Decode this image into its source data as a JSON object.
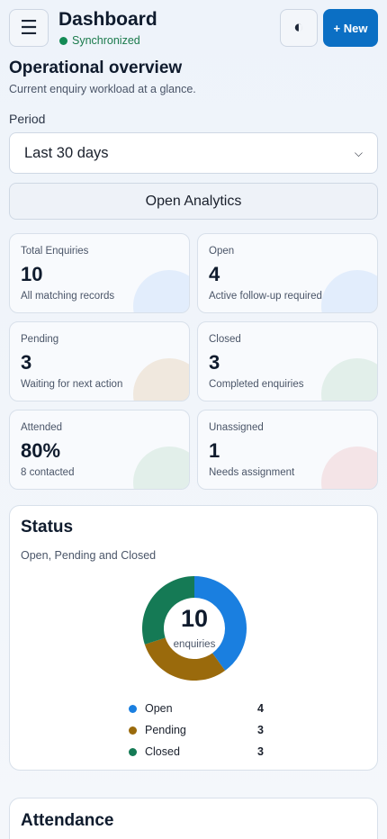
{
  "header": {
    "menu_icon": "☰",
    "title": "Dashboard",
    "sync_status": "Synchronized",
    "theme_icon": "◐",
    "new_label": "+ New"
  },
  "overview": {
    "title": "Operational overview",
    "subtitle": "Current enquiry workload at a glance.",
    "period_label": "Period",
    "period_value": "Last 30 days",
    "analytics_label": "Open Analytics"
  },
  "cards": [
    {
      "label": "Total Enquiries",
      "value": "10",
      "note": "All matching records",
      "accent": "#cfe2fb"
    },
    {
      "label": "Open",
      "value": "4",
      "note": "Active follow-up required",
      "accent": "#cfe2fb"
    },
    {
      "label": "Pending",
      "value": "3",
      "note": "Waiting for next action",
      "accent": "#ead9c4"
    },
    {
      "label": "Closed",
      "value": "3",
      "note": "Completed enquiries",
      "accent": "#cfe6da"
    },
    {
      "label": "Attended",
      "value": "80%",
      "note": "8 contacted",
      "accent": "#cfe6da"
    },
    {
      "label": "Unassigned",
      "value": "1",
      "note": "Needs assignment",
      "accent": "#f0d2d5"
    }
  ],
  "status": {
    "title": "Status",
    "subtitle": "Open, Pending and Closed",
    "total": "10",
    "total_label": "enquiries"
  },
  "chart_data": {
    "type": "pie",
    "categories": [
      "Open",
      "Pending",
      "Closed"
    ],
    "values": [
      4,
      3,
      3
    ],
    "colors": [
      "#1a7fe0",
      "#9a6a0c",
      "#157a55"
    ],
    "title": "Status",
    "subtitle": "Open, Pending and Closed"
  },
  "attendance": {
    "title": "Attendance"
  }
}
